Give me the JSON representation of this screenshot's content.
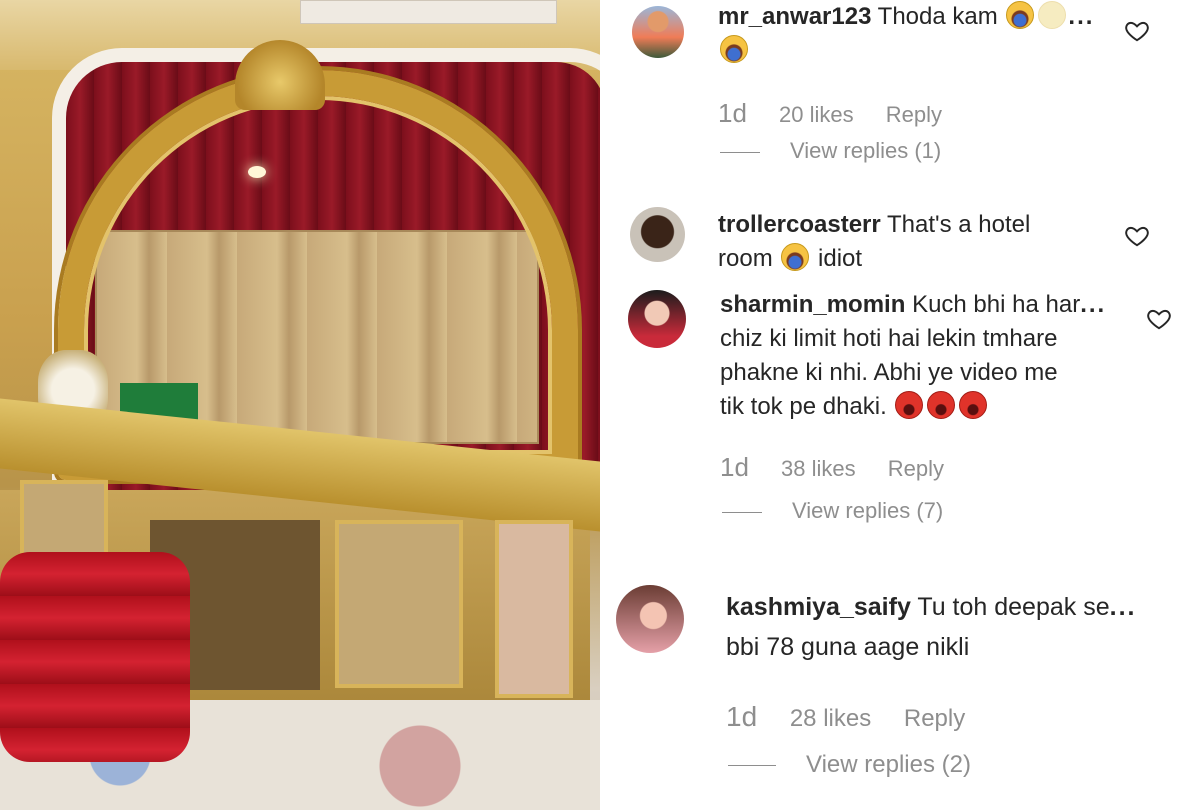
{
  "comments": [
    {
      "username": "mr_anwar123",
      "text_line1": "Thoda kam",
      "text_line2": "",
      "text_line3": "",
      "text_line4": "",
      "time": "1d",
      "likes": "20 likes",
      "reply": "Reply",
      "view_replies": "View replies (1)"
    },
    {
      "username": "trollercoasterr",
      "text_line1": "That's a hotel",
      "text_line2": "room",
      "text_line2_after": "idiot"
    },
    {
      "username": "sharmin_momin",
      "text_line1": "Kuch bhi ha har",
      "text_line2": "chiz ki limit hoti hai lekin tmhare",
      "text_line3": "phakne ki nhi. Abhi ye video me",
      "text_line4": "tik tok pe dhaki.",
      "time": "1d",
      "likes": "38 likes",
      "reply": "Reply",
      "view_replies": "View replies (7)"
    },
    {
      "username": "kashmiya_saify",
      "text_line1": "Tu toh deepak se",
      "text_line2": "bbi 78 guna aage nikli",
      "time": "1d",
      "likes": "28 likes",
      "reply": "Reply",
      "view_replies": "View replies (2)"
    }
  ],
  "ellipsis": "...",
  "icons": {
    "heart": "heart-outline-icon",
    "laugh": "laughing-emoji",
    "angry": "angry-emoji"
  },
  "colors": {
    "text": "#262626",
    "muted": "#8e8e8e"
  }
}
